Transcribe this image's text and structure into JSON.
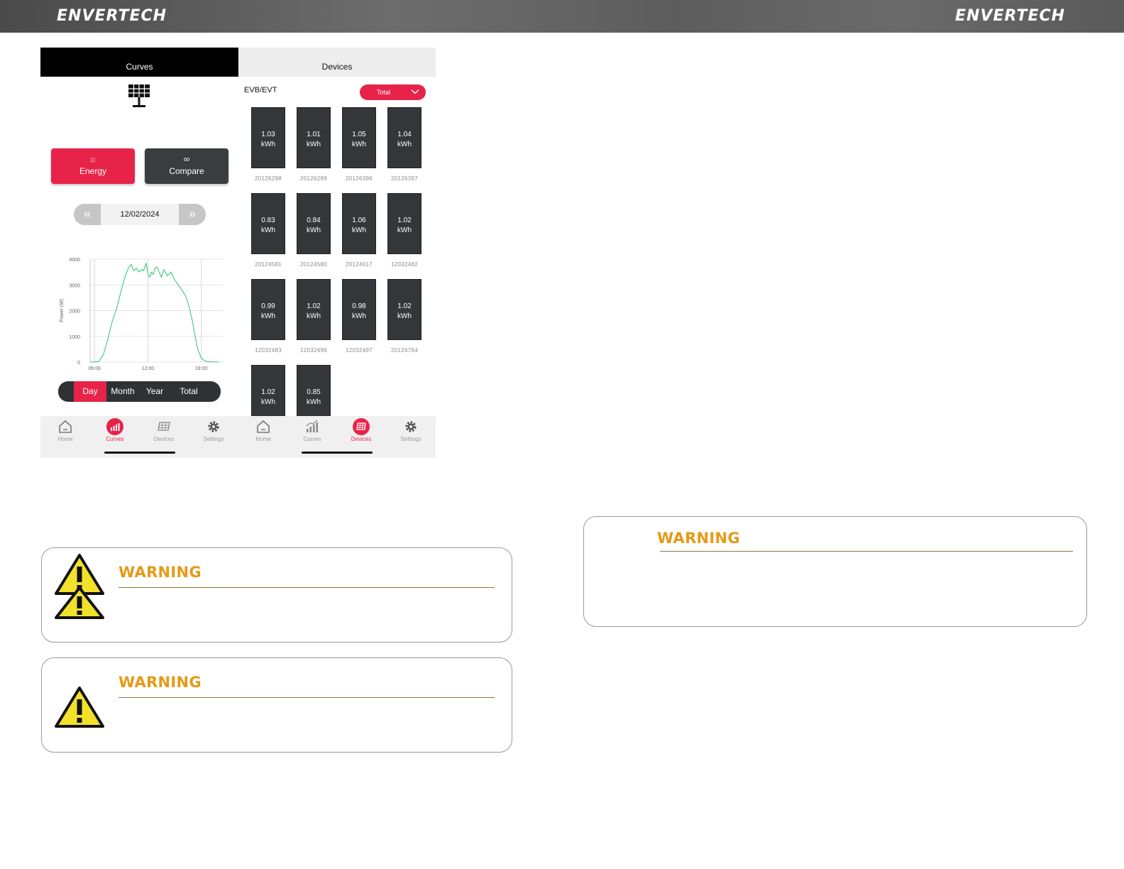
{
  "header": {
    "logo_left": "ENVERTECH",
    "logo_right": "ENVERTECH"
  },
  "colors": {
    "accent": "#e8234a",
    "dark_button": "#3a3d40",
    "warning_title": "#e69a17",
    "warning_icon": "#f2e12b"
  },
  "curves_screen": {
    "tab_curves": "Curves",
    "tab_devices": "Devices",
    "solar_icon": "solar-panel-icon",
    "energy_label": "Energy",
    "compare_label": "Compare",
    "date": "12/02/2024",
    "period_tabs": {
      "day": "Day",
      "month": "Month",
      "year": "Year",
      "total": "Total"
    },
    "nav": {
      "home": "Home",
      "curves": "Curves",
      "devices": "Devices",
      "settings": "Settings"
    }
  },
  "devices_screen": {
    "group_label": "EVB/EVT",
    "filter_selected": "Total",
    "devices": [
      {
        "value": "1.03",
        "unit": "kWh",
        "serial": "20126298"
      },
      {
        "value": "1.01",
        "unit": "kWh",
        "serial": "20126299"
      },
      {
        "value": "1.05",
        "unit": "kWh",
        "serial": "20126396"
      },
      {
        "value": "1.04",
        "unit": "kWh",
        "serial": "20126397"
      },
      {
        "value": "0.83",
        "unit": "kWh",
        "serial": "20124581"
      },
      {
        "value": "0.84",
        "unit": "kWh",
        "serial": "20124580"
      },
      {
        "value": "1.06",
        "unit": "kWh",
        "serial": "20124617"
      },
      {
        "value": "1.02",
        "unit": "kWh",
        "serial": "12032482"
      },
      {
        "value": "0.99",
        "unit": "kWh",
        "serial": "12032483"
      },
      {
        "value": "1.02",
        "unit": "kWh",
        "serial": "12032496"
      },
      {
        "value": "0.98",
        "unit": "kWh",
        "serial": "12032497"
      },
      {
        "value": "1.02",
        "unit": "kWh",
        "serial": "20124764"
      },
      {
        "value": "1.02",
        "unit": "kWh",
        "serial": ""
      },
      {
        "value": "0.85",
        "unit": "kWh",
        "serial": ""
      }
    ],
    "nav": {
      "home": "Home",
      "curves": "Curves",
      "devices": "Devices",
      "settings": "Settings"
    }
  },
  "chart_data": {
    "type": "line",
    "title": "",
    "xlabel": "",
    "ylabel": "Power (W)",
    "x_ticks": [
      "06:00",
      "12:00",
      "18:00"
    ],
    "y_ticks": [
      0,
      1000,
      2000,
      3000,
      4000
    ],
    "xlim": [
      5.5,
      20.5
    ],
    "ylim": [
      0,
      4000
    ],
    "grid": true,
    "series": [
      {
        "color": "#3ec97a",
        "x": [
          5.5,
          6.5,
          7.0,
          7.5,
          8.0,
          8.5,
          9.0,
          9.5,
          9.8,
          10.1,
          10.4,
          10.7,
          11.0,
          11.3,
          11.5,
          11.8,
          12.0,
          12.2,
          12.4,
          12.6,
          12.8,
          13.0,
          13.2,
          13.5,
          13.8,
          14.2,
          14.6,
          15.0,
          15.4,
          15.8,
          16.2,
          16.6,
          17.0,
          17.3,
          17.6,
          18.0,
          18.5,
          19.0,
          20.0
        ],
        "y": [
          0,
          20,
          300,
          900,
          1600,
          2100,
          2800,
          3400,
          3650,
          3800,
          3550,
          3650,
          3500,
          3600,
          3550,
          3850,
          3400,
          3300,
          3500,
          3400,
          3650,
          3700,
          3550,
          3300,
          3600,
          3350,
          3500,
          3200,
          3000,
          2800,
          2600,
          2200,
          1600,
          1000,
          500,
          150,
          30,
          10,
          0
        ]
      }
    ]
  },
  "warnings": [
    {
      "title": "WARNING"
    },
    {
      "title": "WARNING"
    },
    {
      "title": "WARNING"
    }
  ]
}
